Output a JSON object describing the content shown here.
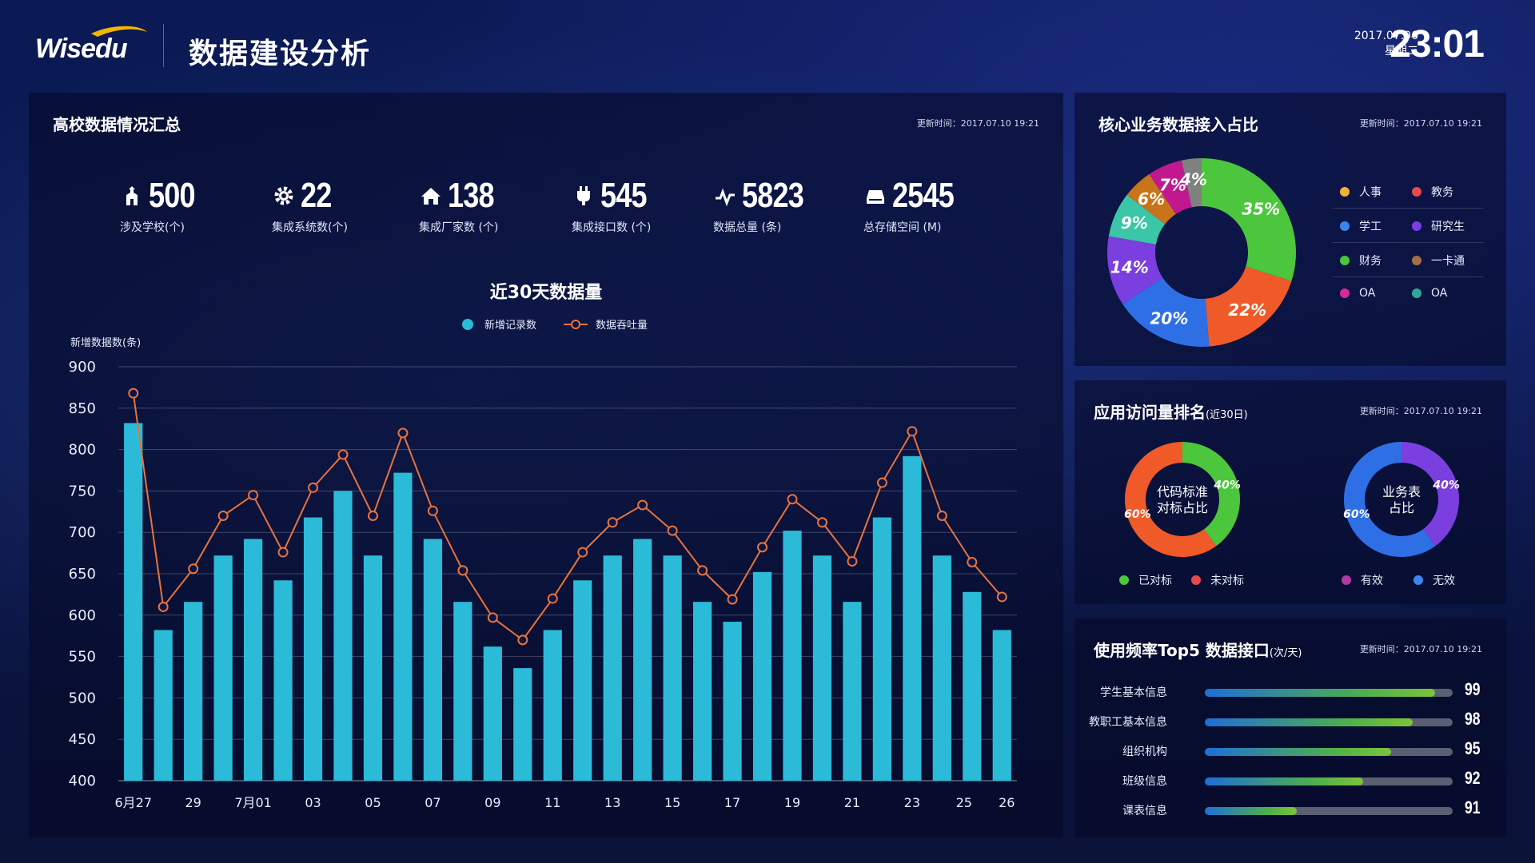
{
  "header": {
    "logo_text": "Wisedu",
    "title": "数据建设分析",
    "date": "2017.07.06",
    "weekday": "星期二",
    "time": "23:01"
  },
  "summary_panel": {
    "title": "高校数据情况汇总",
    "update": "更新时间：2017.07.10 19:21",
    "stats": [
      {
        "value": "500",
        "label": "涉及学校(个)",
        "icon": "school-icon"
      },
      {
        "value": "22",
        "label": "集成系统数(个)",
        "icon": "gear-icon"
      },
      {
        "value": "138",
        "label": "集成厂家数 (个)",
        "icon": "home-icon"
      },
      {
        "value": "545",
        "label": "集成接口数 (个)",
        "icon": "plug-icon"
      },
      {
        "value": "5823",
        "label": "数据总量 (条)",
        "icon": "pulse-icon"
      },
      {
        "value": "2545",
        "label": "总存储空间 (M)",
        "icon": "storage-icon"
      }
    ]
  },
  "chart_data": [
    {
      "type": "bar",
      "title": "近30天数据量",
      "ylabel": "新增数据数(条)",
      "ylim": [
        400,
        900
      ],
      "yticks": [
        900,
        850,
        800,
        750,
        700,
        650,
        600,
        550,
        500,
        450,
        400
      ],
      "xticks": [
        "6月27",
        "29",
        "7月01",
        "03",
        "05",
        "07",
        "09",
        "11",
        "13",
        "15",
        "17",
        "19",
        "21",
        "23",
        "25",
        "26"
      ],
      "colors": {
        "bar": "#2bbbd8",
        "line": "#e8733c"
      },
      "series": [
        {
          "name": "新增记录数",
          "type": "bar",
          "values": [
            832,
            582,
            616,
            672,
            692,
            642,
            718,
            750,
            672,
            772,
            692,
            616,
            562,
            536,
            582,
            642,
            672,
            692,
            672,
            616,
            592,
            652,
            702,
            672,
            616,
            718,
            792,
            672,
            628,
            582
          ]
        },
        {
          "name": "数据吞吐量",
          "type": "line",
          "values": [
            868,
            610,
            656,
            720,
            745,
            676,
            754,
            794,
            720,
            820,
            726,
            654,
            597,
            570,
            620,
            676,
            712,
            733,
            702,
            654,
            619,
            682,
            740,
            712,
            665,
            760,
            822,
            720,
            664,
            622
          ]
        }
      ]
    },
    {
      "type": "pie",
      "title": "核心业务数据接入占比",
      "update": "更新时间：2017.07.10 19:21",
      "slices": [
        {
          "name": "人事",
          "value": 35,
          "label": "35%",
          "color": "#4cc63c"
        },
        {
          "name": "教务",
          "value": 22,
          "label": "22%",
          "color": "#f05a28"
        },
        {
          "name": "学工",
          "value": 20,
          "label": "20%",
          "color": "#2e6fe6"
        },
        {
          "name": "研究生",
          "value": 14,
          "label": "14%",
          "color": "#7b3fe0"
        },
        {
          "name": "财务",
          "value": 9,
          "label": "9%",
          "color": "#3cc6a8"
        },
        {
          "name": "一卡通",
          "value": 6,
          "label": "6%",
          "color": "#c8741a"
        },
        {
          "name": "OA",
          "value": 7,
          "label": "7%",
          "color": "#c2188f"
        },
        {
          "name": "OA",
          "value": 4,
          "label": "4%",
          "color": "#808080"
        }
      ],
      "legend": [
        {
          "name": "人事",
          "color": "#f2b134"
        },
        {
          "name": "教务",
          "color": "#e84a4a"
        },
        {
          "name": "学工",
          "color": "#3a86f0"
        },
        {
          "name": "研究生",
          "color": "#7a3fe4"
        },
        {
          "name": "财务",
          "color": "#4cc63c"
        },
        {
          "name": "一卡通",
          "color": "#a0704a"
        },
        {
          "name": "OA",
          "color": "#d42a9c"
        },
        {
          "name": "OA",
          "color": "#2fa89a"
        }
      ]
    },
    {
      "type": "pie",
      "title": "应用访问量排名",
      "title_small": "(近30日)",
      "update": "更新时间：2017.07.10 19:21",
      "donuts": [
        {
          "center_line1": "代码标准",
          "center_line2": "对标占比",
          "slices": [
            {
              "name": "已对标",
              "value": 40,
              "label": "40%",
              "color": "#4cc63c"
            },
            {
              "name": "未对标",
              "value": 60,
              "label": "60%",
              "color": "#f05a28"
            }
          ]
        },
        {
          "center_line1": "业务表",
          "center_line2": "占比",
          "slices": [
            {
              "name": "有效",
              "value": 40,
              "label": "40%",
              "color": "#7b3fe0"
            },
            {
              "name": "无效",
              "value": 60,
              "label": "60%",
              "color": "#2e6fe6"
            }
          ]
        }
      ],
      "legend": [
        {
          "name": "已对标",
          "color": "#4cc63c"
        },
        {
          "name": "未对标",
          "color": "#e84a4a"
        },
        {
          "name": "有效",
          "color": "#b03aa8"
        },
        {
          "name": "无效",
          "color": "#3a86f0"
        }
      ]
    },
    {
      "type": "bar",
      "orientation": "horizontal",
      "title": "使用频率Top5 数据接口",
      "title_small": "(次/天)",
      "update": "更新时间：2017.07.10 19:21",
      "categories": [
        "学生基本信息",
        "教职工基本信息",
        "组织机构",
        "班级信息",
        "课表信息"
      ],
      "values": [
        99,
        98,
        95,
        92,
        91
      ],
      "fill_ratio": [
        0.93,
        0.84,
        0.75,
        0.64,
        0.37
      ]
    }
  ]
}
